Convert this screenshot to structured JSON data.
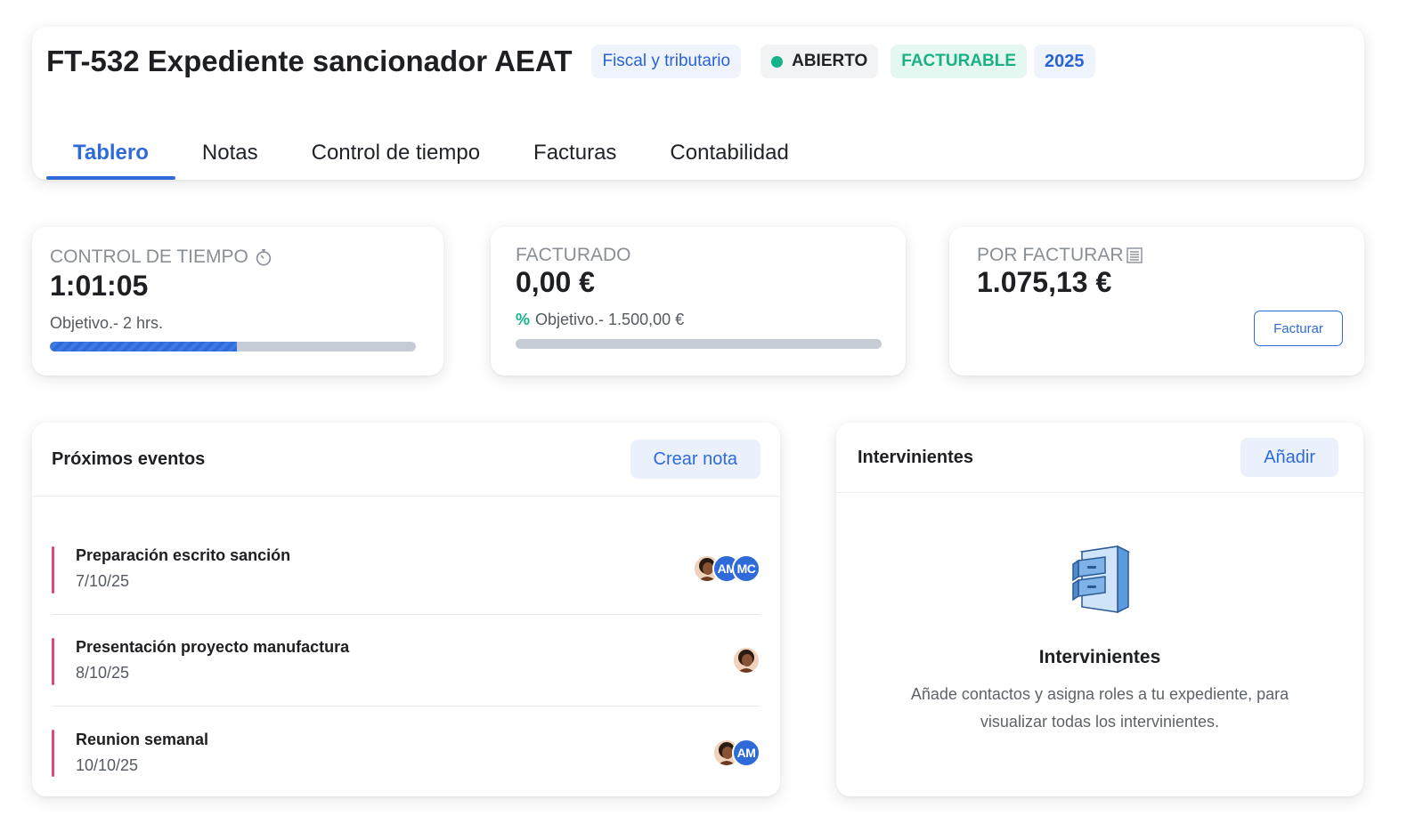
{
  "header": {
    "title": "FT-532 Expediente sancionador AEAT",
    "badges": {
      "area": "Fiscal y tributario",
      "status": "ABIERTO",
      "billing": "FACTURABLE",
      "year": "2025"
    },
    "tabs": [
      {
        "label": "Tablero",
        "active": true
      },
      {
        "label": "Notas",
        "active": false
      },
      {
        "label": "Control de tiempo",
        "active": false
      },
      {
        "label": "Facturas",
        "active": false
      },
      {
        "label": "Contabilidad",
        "active": false
      }
    ]
  },
  "stats": {
    "time": {
      "label": "CONTROL DE TIEMPO",
      "icon": "stopwatch-icon",
      "value": "1:01:05",
      "target": "Objetivo.- 2 hrs.",
      "progress": 0.51
    },
    "billed": {
      "label": "FACTURADO",
      "value": "0,00 €",
      "target_symbol": "%",
      "target": "Objetivo.- 1.500,00 €",
      "progress": 0
    },
    "unbilled": {
      "label": "POR FACTURAR",
      "icon": "document-icon",
      "value": "1.075,13 €",
      "button": "Facturar"
    }
  },
  "events": {
    "title": "Próximos eventos",
    "button": "Crear nota",
    "items": [
      {
        "name": "Preparación escrito sanción",
        "date": "7/10/25",
        "avatars": [
          {
            "type": "photo"
          },
          {
            "type": "initials",
            "text": "AM"
          },
          {
            "type": "initials",
            "text": "MC"
          }
        ]
      },
      {
        "name": "Presentación proyecto manufactura",
        "date": "8/10/25",
        "avatars": [
          {
            "type": "photo"
          }
        ]
      },
      {
        "name": "Reunion semanal",
        "date": "10/10/25",
        "avatars": [
          {
            "type": "photo"
          },
          {
            "type": "initials",
            "text": "AM"
          }
        ]
      }
    ]
  },
  "participants": {
    "title": "Intervinientes",
    "button": "Añadir",
    "empty_icon": "file-cabinet-icon",
    "empty_title": "Intervinientes",
    "empty_text": "Añade contactos y asigna roles a tu expediente, para visualizar todas los intervinientes."
  },
  "colors": {
    "accent": "#2f6bd8",
    "status_dot": "#15b38a",
    "event_bar": "#e0457b"
  }
}
